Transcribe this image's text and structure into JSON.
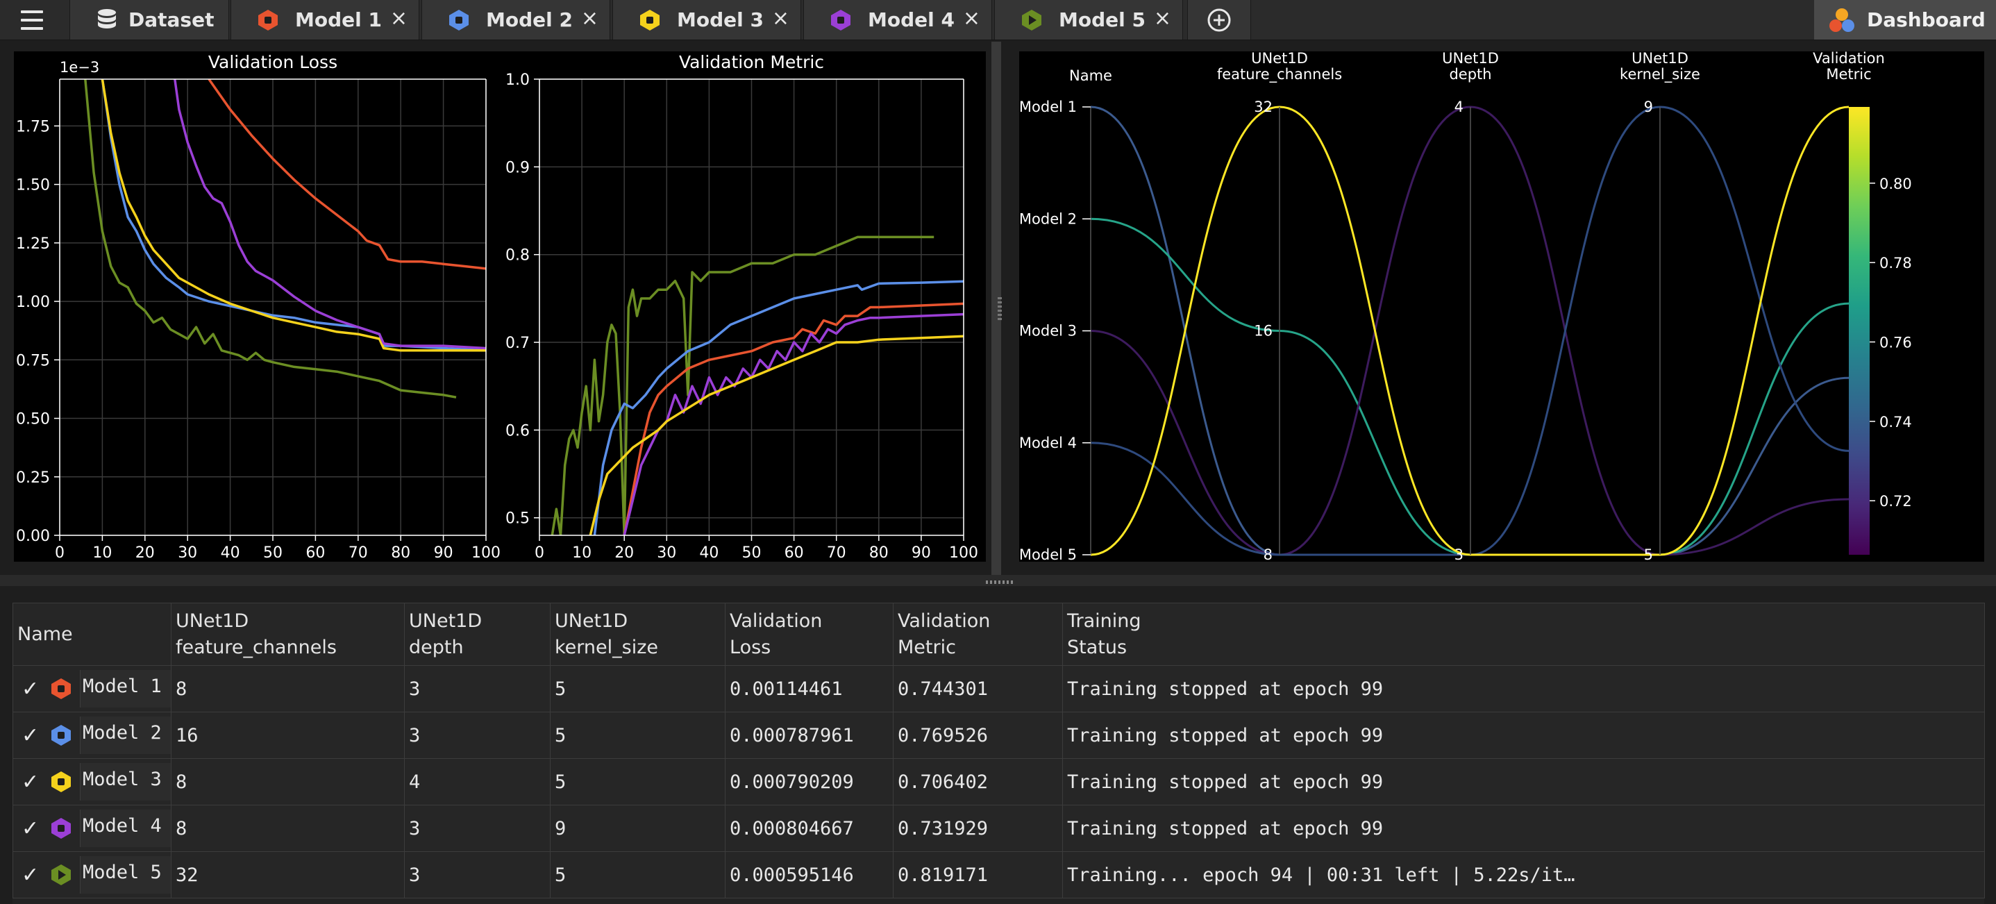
{
  "tabs": {
    "dataset": {
      "label": "Dataset"
    },
    "models": [
      {
        "label": "Model 1",
        "color": "#e8542f",
        "shape": "hexagon"
      },
      {
        "label": "Model 2",
        "color": "#5b8fe8",
        "shape": "hexagon"
      },
      {
        "label": "Model 3",
        "color": "#f5d21c",
        "shape": "hexagon"
      },
      {
        "label": "Model 4",
        "color": "#9b3fd6",
        "shape": "hexagon"
      },
      {
        "label": "Model 5",
        "color": "#6b8e23",
        "shape": "play"
      }
    ],
    "close_glyph": "×",
    "dashboard": {
      "label": "Dashboard"
    }
  },
  "chart_data": [
    {
      "type": "line",
      "title": "Validation Loss",
      "offset_label": "1e−3",
      "xlim": [
        0,
        100
      ],
      "ylim": [
        0,
        1.95
      ],
      "xticks": [
        0,
        10,
        20,
        30,
        40,
        50,
        60,
        70,
        80,
        90,
        100
      ],
      "yticks": [
        "0.00",
        "0.25",
        "0.50",
        "0.75",
        "1.00",
        "1.25",
        "1.50",
        "1.75"
      ],
      "grid": true,
      "series": [
        {
          "color": "#e8542f",
          "x": [
            35,
            40,
            45,
            50,
            55,
            60,
            65,
            70,
            72,
            75,
            77,
            80,
            85,
            90,
            95,
            100
          ],
          "y": [
            1.95,
            1.82,
            1.71,
            1.61,
            1.52,
            1.44,
            1.37,
            1.3,
            1.26,
            1.24,
            1.18,
            1.17,
            1.17,
            1.16,
            1.15,
            1.14
          ]
        },
        {
          "color": "#5b8fe8",
          "x": [
            10,
            12,
            14,
            16,
            18,
            20,
            22,
            25,
            28,
            30,
            35,
            40,
            45,
            50,
            55,
            60,
            65,
            70,
            75,
            76,
            80,
            90,
            100
          ],
          "y": [
            1.95,
            1.7,
            1.5,
            1.36,
            1.3,
            1.22,
            1.16,
            1.1,
            1.06,
            1.03,
            1.0,
            0.98,
            0.96,
            0.94,
            0.93,
            0.91,
            0.9,
            0.89,
            0.86,
            0.81,
            0.81,
            0.8,
            0.79
          ]
        },
        {
          "color": "#f5d21c",
          "x": [
            10,
            12,
            14,
            16,
            18,
            20,
            22,
            25,
            28,
            30,
            35,
            40,
            45,
            50,
            55,
            60,
            65,
            70,
            75,
            76,
            80,
            90,
            100
          ],
          "y": [
            1.95,
            1.72,
            1.55,
            1.43,
            1.36,
            1.28,
            1.22,
            1.16,
            1.1,
            1.08,
            1.03,
            0.99,
            0.96,
            0.93,
            0.91,
            0.89,
            0.87,
            0.86,
            0.84,
            0.8,
            0.79,
            0.79,
            0.79
          ]
        },
        {
          "color": "#9b3fd6",
          "x": [
            27,
            28,
            30,
            32,
            34,
            36,
            38,
            40,
            42,
            44,
            46,
            48,
            50,
            55,
            60,
            65,
            70,
            75,
            76,
            80,
            90,
            100
          ],
          "y": [
            1.95,
            1.82,
            1.68,
            1.58,
            1.49,
            1.44,
            1.42,
            1.34,
            1.24,
            1.17,
            1.13,
            1.11,
            1.09,
            1.02,
            0.96,
            0.92,
            0.89,
            0.86,
            0.82,
            0.81,
            0.81,
            0.8
          ]
        },
        {
          "color": "#6b8e23",
          "x": [
            6,
            8,
            10,
            12,
            14,
            16,
            18,
            20,
            22,
            24,
            26,
            28,
            30,
            32,
            34,
            36,
            38,
            40,
            42,
            44,
            46,
            48,
            50,
            55,
            60,
            65,
            70,
            75,
            80,
            85,
            90,
            93
          ],
          "y": [
            1.95,
            1.55,
            1.3,
            1.15,
            1.08,
            1.06,
            0.99,
            0.96,
            0.91,
            0.93,
            0.88,
            0.86,
            0.84,
            0.89,
            0.82,
            0.86,
            0.79,
            0.78,
            0.77,
            0.75,
            0.78,
            0.75,
            0.74,
            0.72,
            0.71,
            0.7,
            0.68,
            0.66,
            0.62,
            0.61,
            0.6,
            0.59
          ]
        }
      ]
    },
    {
      "type": "line",
      "title": "Validation Metric",
      "xlim": [
        0,
        100
      ],
      "ylim": [
        0.48,
        1.0
      ],
      "xticks": [
        0,
        10,
        20,
        30,
        40,
        50,
        60,
        70,
        80,
        90,
        100
      ],
      "yticks": [
        "0.5",
        "0.6",
        "0.7",
        "0.8",
        "0.9",
        "1.0"
      ],
      "grid": true,
      "series": [
        {
          "color": "#6b8e23",
          "x": [
            3,
            4,
            5,
            6,
            7,
            8,
            9,
            10,
            11,
            12,
            13,
            14,
            15,
            16,
            17,
            18,
            19,
            20,
            21,
            22,
            23,
            24,
            26,
            28,
            30,
            32,
            34,
            35,
            36,
            38,
            40,
            45,
            50,
            55,
            60,
            65,
            70,
            75,
            80,
            85,
            90,
            93
          ],
          "y": [
            0.48,
            0.51,
            0.48,
            0.56,
            0.59,
            0.6,
            0.58,
            0.62,
            0.65,
            0.6,
            0.68,
            0.61,
            0.64,
            0.7,
            0.72,
            0.71,
            0.62,
            0.48,
            0.74,
            0.76,
            0.73,
            0.75,
            0.75,
            0.76,
            0.76,
            0.77,
            0.75,
            0.64,
            0.78,
            0.77,
            0.78,
            0.78,
            0.79,
            0.79,
            0.8,
            0.8,
            0.81,
            0.82,
            0.82,
            0.82,
            0.82,
            0.82
          ]
        },
        {
          "color": "#5b8fe8",
          "x": [
            13,
            14,
            15,
            16,
            17,
            18,
            20,
            22,
            25,
            28,
            30,
            35,
            40,
            45,
            50,
            55,
            60,
            65,
            70,
            75,
            76,
            80,
            90,
            100
          ],
          "y": [
            0.48,
            0.52,
            0.56,
            0.58,
            0.6,
            0.61,
            0.63,
            0.625,
            0.64,
            0.66,
            0.67,
            0.69,
            0.7,
            0.72,
            0.73,
            0.74,
            0.75,
            0.755,
            0.76,
            0.765,
            0.76,
            0.767,
            0.768,
            0.7695
          ]
        },
        {
          "color": "#e8542f",
          "x": [
            20,
            22,
            24,
            26,
            28,
            30,
            35,
            40,
            45,
            50,
            55,
            60,
            62,
            65,
            67,
            70,
            72,
            75,
            78,
            80,
            90,
            100
          ],
          "y": [
            0.48,
            0.53,
            0.58,
            0.62,
            0.64,
            0.65,
            0.67,
            0.68,
            0.685,
            0.69,
            0.7,
            0.705,
            0.715,
            0.71,
            0.725,
            0.72,
            0.73,
            0.73,
            0.74,
            0.74,
            0.742,
            0.744
          ]
        },
        {
          "color": "#9b3fd6",
          "x": [
            20,
            22,
            24,
            26,
            28,
            30,
            32,
            34,
            36,
            38,
            40,
            42,
            44,
            46,
            48,
            50,
            52,
            54,
            56,
            58,
            60,
            62,
            64,
            66,
            68,
            70,
            72,
            75,
            78,
            80,
            90,
            100
          ],
          "y": [
            0.48,
            0.52,
            0.56,
            0.58,
            0.6,
            0.61,
            0.64,
            0.62,
            0.65,
            0.63,
            0.66,
            0.64,
            0.66,
            0.65,
            0.67,
            0.66,
            0.68,
            0.67,
            0.69,
            0.68,
            0.7,
            0.69,
            0.71,
            0.7,
            0.715,
            0.71,
            0.72,
            0.725,
            0.728,
            0.728,
            0.73,
            0.732
          ]
        },
        {
          "color": "#f5d21c",
          "x": [
            12,
            14,
            16,
            18,
            20,
            22,
            25,
            28,
            30,
            35,
            40,
            45,
            50,
            55,
            60,
            65,
            70,
            75,
            80,
            90,
            100
          ],
          "y": [
            0.48,
            0.52,
            0.55,
            0.56,
            0.57,
            0.58,
            0.59,
            0.6,
            0.61,
            0.625,
            0.64,
            0.65,
            0.66,
            0.67,
            0.68,
            0.69,
            0.7,
            0.7,
            0.703,
            0.705,
            0.707
          ]
        }
      ]
    },
    {
      "type": "parallel_coordinates",
      "axes": [
        {
          "title": [
            "Name"
          ],
          "ticks": [
            {
              "label": "Model 1",
              "v": 0
            },
            {
              "label": "Model 2",
              "v": 0.25
            },
            {
              "label": "Model 3",
              "v": 0.5
            },
            {
              "label": "Model 4",
              "v": 0.75
            },
            {
              "label": "Model 5",
              "v": 1
            }
          ]
        },
        {
          "title": [
            "UNet1D",
            "feature_channels"
          ],
          "ticks": [
            {
              "label": "32",
              "v": 0
            },
            {
              "label": "16",
              "v": 0.5
            },
            {
              "label": "8",
              "v": 1
            }
          ]
        },
        {
          "title": [
            "UNet1D",
            "depth"
          ],
          "ticks": [
            {
              "label": "4",
              "v": 0
            },
            {
              "label": "3",
              "v": 1
            }
          ]
        },
        {
          "title": [
            "UNet1D",
            "kernel_size"
          ],
          "ticks": [
            {
              "label": "9",
              "v": 0
            },
            {
              "label": "5",
              "v": 1
            }
          ]
        },
        {
          "title": [
            "Validation",
            "Metric"
          ],
          "ticks": []
        }
      ],
      "lines": [
        {
          "model": "Model 1",
          "norm": [
            0,
            1,
            1,
            1,
            0.605
          ],
          "color": "#3b5a8e"
        },
        {
          "model": "Model 2",
          "norm": [
            0.25,
            0.5,
            1,
            1,
            0.439
          ],
          "color": "#26a489"
        },
        {
          "model": "Model 3",
          "norm": [
            0.5,
            1,
            0,
            1,
            0.876
          ],
          "color": "#3d1b5e"
        },
        {
          "model": "Model 4",
          "norm": [
            0.75,
            1,
            1,
            0,
            0.768
          ],
          "color": "#2e4a7e"
        },
        {
          "model": "Model 5",
          "norm": [
            1,
            0,
            1,
            1,
            0
          ],
          "color": "#fde725"
        }
      ],
      "colorbar": {
        "ticks": [
          "0.80",
          "0.78",
          "0.76",
          "0.74",
          "0.72"
        ],
        "range": [
          0.7064,
          0.8192
        ]
      }
    }
  ],
  "table": {
    "headers": [
      [
        "Name",
        ""
      ],
      [
        "UNet1D",
        "feature_channels"
      ],
      [
        "UNet1D",
        "depth"
      ],
      [
        "UNet1D",
        "kernel_size"
      ],
      [
        "Validation",
        "Loss"
      ],
      [
        "Validation",
        "Metric"
      ],
      [
        "Training",
        "Status"
      ]
    ],
    "rows": [
      {
        "check": "✓",
        "name": "Model 1",
        "feature_channels": "8",
        "depth": "3",
        "kernel_size": "5",
        "loss": "0.00114461",
        "metric": "0.744301",
        "status": "Training stopped at epoch 99"
      },
      {
        "check": "✓",
        "name": "Model 2",
        "feature_channels": "16",
        "depth": "3",
        "kernel_size": "5",
        "loss": "0.000787961",
        "metric": "0.769526",
        "status": "Training stopped at epoch 99"
      },
      {
        "check": "✓",
        "name": "Model 3",
        "feature_channels": "8",
        "depth": "4",
        "kernel_size": "5",
        "loss": "0.000790209",
        "metric": "0.706402",
        "status": "Training stopped at epoch 99"
      },
      {
        "check": "✓",
        "name": "Model 4",
        "feature_channels": "8",
        "depth": "3",
        "kernel_size": "9",
        "loss": "0.000804667",
        "metric": "0.731929",
        "status": "Training stopped at epoch 99"
      },
      {
        "check": "✓",
        "name": "Model 5",
        "feature_channels": "32",
        "depth": "3",
        "kernel_size": "5",
        "loss": "0.000595146",
        "metric": "0.819171",
        "status": "Training... epoch 94 | 00:31 left | 5.22s/it…"
      }
    ]
  }
}
